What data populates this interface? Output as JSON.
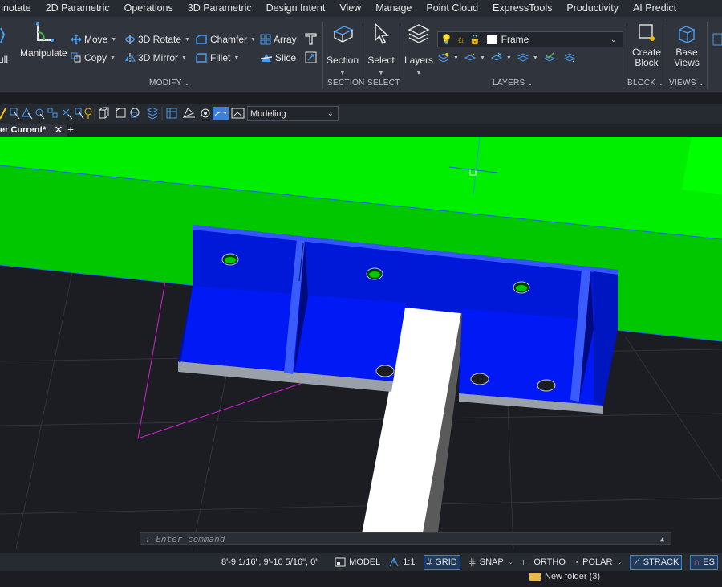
{
  "menu": [
    "nnotate",
    "2D Parametric",
    "Operations",
    "3D Parametric",
    "Design Intent",
    "View",
    "Manage",
    "Point Cloud",
    "ExpressTools",
    "Productivity",
    "AI Predict"
  ],
  "ribbon": {
    "pull_label": "ull",
    "manipulate_label": "Manipulate",
    "modify": {
      "move": "Move",
      "rotate3d": "3D Rotate",
      "chamfer": "Chamfer",
      "array": "Array",
      "copy": "Copy",
      "mirror3d": "3D Mirror",
      "fillet": "Fillet",
      "slice": "Slice"
    },
    "section_label": "Section",
    "select_label": "Select",
    "layers_label": "Layers",
    "layer_current": "Frame",
    "create_block": [
      "Create",
      "Block"
    ],
    "base_views": [
      "Base",
      "Views"
    ],
    "groups": {
      "modify": "MODIFY",
      "section": "SECTION",
      "select": "SELECT",
      "layers": "LAYERS",
      "block": "BLOCK",
      "views": "VIEWS"
    }
  },
  "toolbar": {
    "workspace": "Modeling"
  },
  "tabs": {
    "current": "er Current*"
  },
  "command": {
    "prompt": ": Enter command"
  },
  "status": {
    "coords": "8'-9 1/16\", 9'-10 5/16\", 0\"",
    "model": "MODEL",
    "scale": "1:1",
    "grid": "GRID",
    "snap": "SNAP",
    "ortho": "ORTHO",
    "polar": "POLAR",
    "strack": "STRACK",
    "es": "ES"
  },
  "taskbar": {
    "folder": "New folder (3)"
  },
  "colors": {
    "accent": "#3f7fdc",
    "model_green": "#00ee00",
    "model_blue": "#0019f5",
    "magenta": "#cc22cc",
    "background": "#1b1d22"
  }
}
